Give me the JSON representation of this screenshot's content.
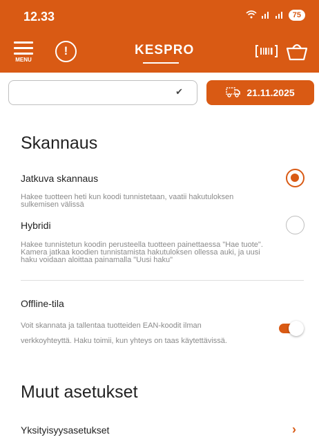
{
  "status_bar": {
    "time": "12.33",
    "battery": "75"
  },
  "header": {
    "menu_label": "MENU",
    "logo": "KESPRO"
  },
  "selector": {
    "value": "",
    "date": "21.11.2025"
  },
  "scan_section": {
    "title": "Skannaus",
    "options": [
      {
        "label": "Jatkuva skannaus",
        "desc": "Hakee tuotteen heti kun koodi tunnistetaan, vaatii hakutuloksen sulkemisen välissä",
        "selected": true
      },
      {
        "label": "Hybridi",
        "desc": "Hakee tunnistetun koodin perusteella tuotteen painettaessa \"Hae tuote\". Kamera jatkaa koodien tunnistamista hakutuloksen ollessa auki, ja uusi haku voidaan aloittaa painamalla \"Uusi haku\"",
        "selected": false
      }
    ],
    "offline": {
      "label": "Offline-tila",
      "desc": "Voit skannata ja tallentaa tuotteiden EAN-koodit ilman verkkoyhteyttä. Haku toimii, kun yhteys on taas käytettävissä.",
      "enabled": true
    }
  },
  "other_section": {
    "title": "Muut asetukset",
    "items": [
      {
        "label": "Yksityisyysasetukset"
      }
    ]
  },
  "colors": {
    "accent": "#d95a14",
    "text": "#222222",
    "muted": "#8a8a8a"
  }
}
